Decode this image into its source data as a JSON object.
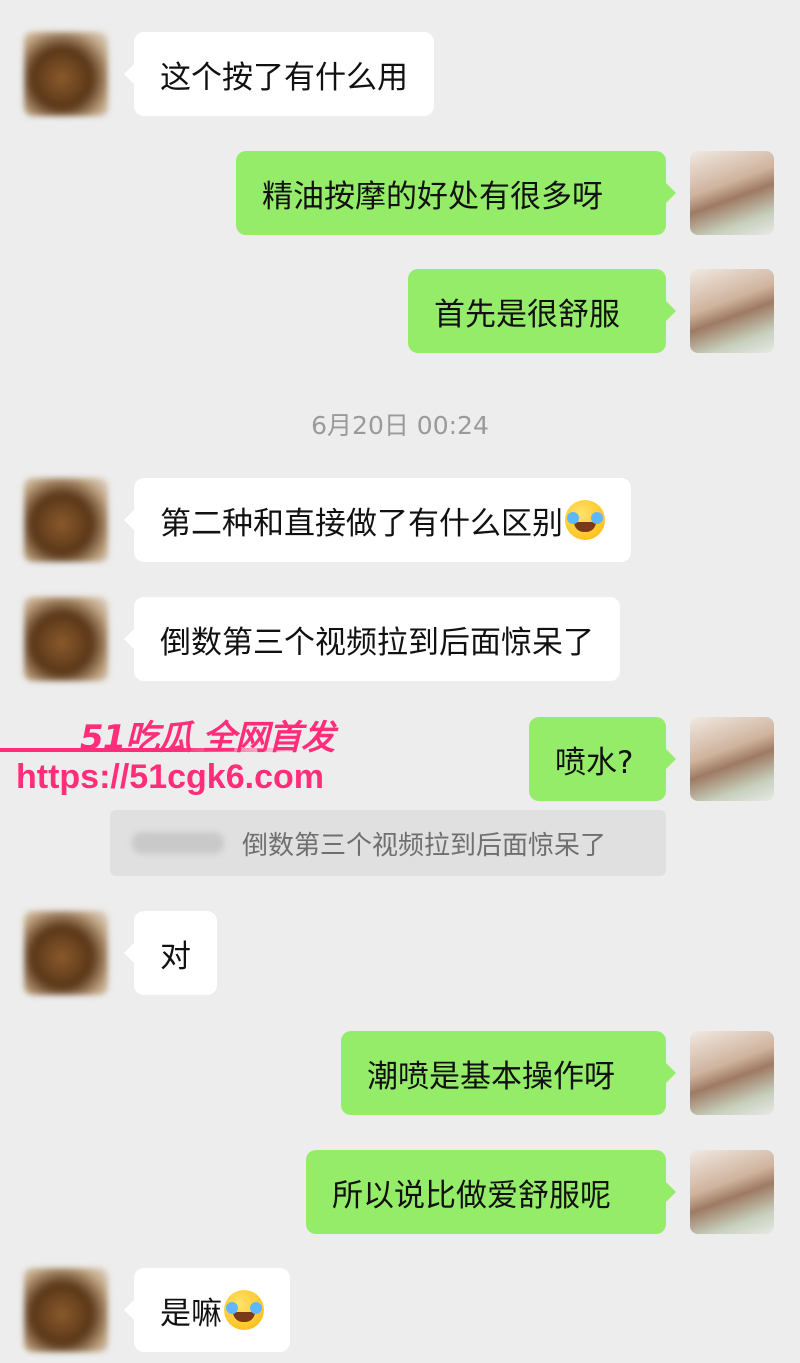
{
  "timestamp": "6月20日 00:24",
  "messages": [
    {
      "side": "left",
      "text": "这个按了有什么用"
    },
    {
      "side": "right",
      "text": "精油按摩的好处有很多呀"
    },
    {
      "side": "right",
      "text": "首先是很舒服"
    },
    {
      "side": "left",
      "text": "第二种和直接做了有什么区别",
      "emoji": "rofl-emoji"
    },
    {
      "side": "left",
      "text": "倒数第三个视频拉到后面惊呆了"
    },
    {
      "side": "right",
      "text": "喷水?"
    },
    {
      "side": "left",
      "text": "对"
    },
    {
      "side": "right",
      "text": "潮喷是基本操作呀"
    },
    {
      "side": "right",
      "text": "所以说比做爱舒服呢"
    },
    {
      "side": "left",
      "text": "是嘛",
      "emoji": "rofl-emoji"
    }
  ],
  "quote": {
    "text": "倒数第三个视频拉到后面惊呆了"
  },
  "watermark": {
    "brand": "51吃瓜 全网首发",
    "url": "https://51cgk6.com"
  },
  "colors": {
    "background": "#ededed",
    "bubble_self": "#95ec69",
    "bubble_other": "#ffffff",
    "watermark": "#ff2d7a"
  }
}
